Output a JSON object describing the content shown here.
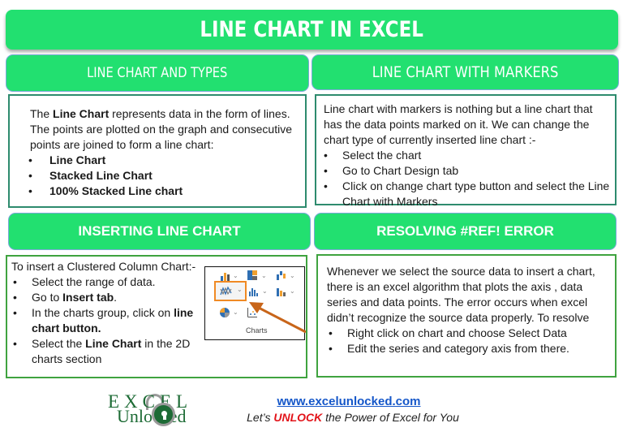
{
  "title": "LINE CHART IN EXCEL",
  "sections": {
    "types": {
      "header": "LINE CHART AND TYPES",
      "intro_pre": "The ",
      "intro_bold": "Line Chart",
      "intro_post": " represents data in the form of lines. The points are plotted on the graph and consecutive points are joined to form a line chart:",
      "bullets": [
        "Line Chart",
        "Stacked Line Chart",
        "100% Stacked Line chart"
      ]
    },
    "markers": {
      "header": "LINE CHART WITH MARKERS",
      "intro": "Line chart with markers is nothing but a line chart that has the data points marked on it. We can change the chart type of currently inserted line chart :-",
      "bullets": [
        "Select the chart",
        "Go to Chart Design tab",
        "Click on change chart type button and select the Line Chart with Markers"
      ]
    },
    "inserting": {
      "header": "INSERTING LINE CHART",
      "intro": "To insert a Clustered Column Chart:-",
      "b1": "Select the range of data.",
      "b2_pre": "Go to ",
      "b2_bold": "Insert tab",
      "b2_post": ".",
      "b3_pre": "In the charts group, click on ",
      "b3_bold": "line chart button.",
      "b4_pre": "Select the ",
      "b4_bold": "Line Chart",
      "b4_post": " in the 2D charts section",
      "ribbon_label": "Charts"
    },
    "ref_error": {
      "header": "RESOLVING #REF! ERROR",
      "intro": "Whenever we select the source data to insert a chart, there is an excel algorithm that plots the axis , data series and data points. The error occurs when excel didn’t recognize the source data properly. To resolve",
      "bullets": [
        "Right click on chart and choose Select Data",
        " Edit the series and category axis from there."
      ]
    }
  },
  "footer": {
    "logo_top": "EXCEL",
    "logo_bottom": "Unlocked",
    "url": "www.excelunlocked.com",
    "tagline_pre": "Let’s ",
    "tagline_highlight": "UNLOCK",
    "tagline_post": " the Power of Excel for You"
  },
  "colors": {
    "header_green": "#22e070",
    "logo_green": "#1d6b35",
    "link_blue": "#1557c9",
    "highlight_red": "#e2141a",
    "callout_orange": "#f08a24"
  }
}
